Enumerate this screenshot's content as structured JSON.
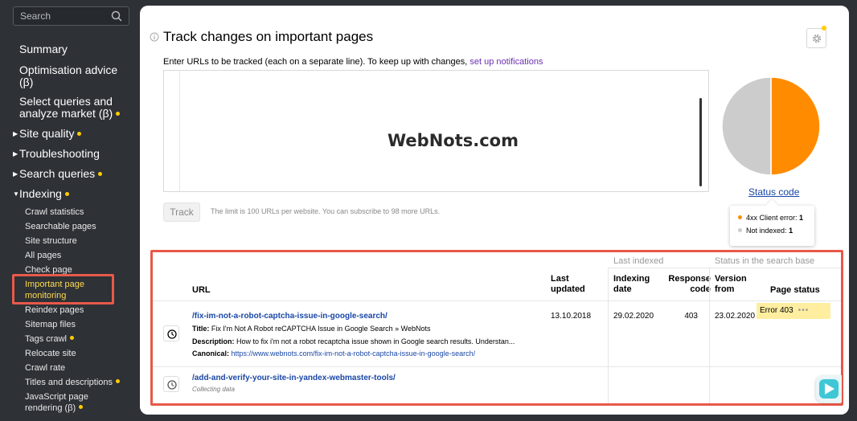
{
  "sidebar": {
    "search_placeholder": "Search",
    "top_items": [
      {
        "label": "Summary"
      },
      {
        "label": "Optimisation advice (β)"
      },
      {
        "label": "Select queries and analyze market (β)"
      }
    ],
    "sections": [
      {
        "label": "Site quality"
      },
      {
        "label": "Troubleshooting"
      },
      {
        "label": "Search queries"
      },
      {
        "label": "Indexing"
      }
    ],
    "sub_items": [
      {
        "label": "Crawl statistics"
      },
      {
        "label": "Searchable pages"
      },
      {
        "label": "Site structure"
      },
      {
        "label": "All pages"
      },
      {
        "label": "Check page"
      },
      {
        "label": "Important page monitoring"
      },
      {
        "label": "Reindex pages"
      },
      {
        "label": "Sitemap files"
      },
      {
        "label": "Tags crawl"
      },
      {
        "label": "Relocate site"
      },
      {
        "label": "Crawl rate"
      },
      {
        "label": "Titles and descriptions"
      },
      {
        "label": "JavaScript page rendering (β)"
      }
    ]
  },
  "main": {
    "title": "Track changes on important pages",
    "instructions": "Enter URLs to be tracked (each on a separate line). To keep up with changes,",
    "instructions_link": "set up notifications",
    "watermark": "WebNots.com",
    "track_button": "Track",
    "limit_text": "The limit is 100 URLs per website. You can subscribe to 98 more URLs."
  },
  "chart_data": {
    "type": "pie",
    "link_label": "Status code",
    "slices": [
      {
        "label": "4xx Client error:",
        "value": 1,
        "color": "#ff8c00"
      },
      {
        "label": "Not indexed:",
        "value": 1,
        "color": "#cccccc"
      }
    ]
  },
  "table": {
    "groups": {
      "last_indexed": "Last indexed",
      "status": "Status in the search base"
    },
    "headers": {
      "url": "URL",
      "last_updated": "Last updated",
      "indexing_date": "Indexing date",
      "response_code": "Response code",
      "version_from": "Version from",
      "page_status": "Page status"
    },
    "rows": [
      {
        "url": "/fix-im-not-a-robot-captcha-issue-in-google-search/",
        "title_label": "Title:",
        "title": "Fix I'm Not A Robot reCAPTCHA Issue in Google Search » WebNots",
        "description_label": "Description:",
        "description": "How to fix i'm not a robot recaptcha issue shown in Google search results. Understan...",
        "canonical_label": "Canonical:",
        "canonical": "https://www.webnots.com/fix-im-not-a-robot-captcha-issue-in-google-search/",
        "last_updated": "13.10.2018",
        "indexing_date": "29.02.2020",
        "response_code": "403",
        "version_from": "23.02.2020",
        "page_status": "Error 403",
        "more": "•••"
      },
      {
        "url": "/add-and-verify-your-site-in-yandex-webmaster-tools/",
        "status_text": "Collecting data"
      }
    ]
  }
}
